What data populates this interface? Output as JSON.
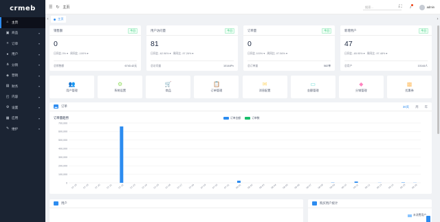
{
  "app": {
    "logo": "crmeb"
  },
  "sidebar": {
    "items": [
      {
        "label": "主页",
        "icon": "home-icon",
        "glyph": "⌂",
        "active": true
      },
      {
        "label": "商品",
        "icon": "goods-icon",
        "glyph": "▣"
      },
      {
        "label": "订单",
        "icon": "order-icon",
        "glyph": "≡"
      },
      {
        "label": "用户",
        "icon": "user-icon",
        "glyph": "●"
      },
      {
        "label": "分销",
        "icon": "distribution-icon",
        "glyph": "⋔"
      },
      {
        "label": "营销",
        "icon": "marketing-icon",
        "glyph": "◈"
      },
      {
        "label": "财务",
        "icon": "finance-icon",
        "glyph": "▤"
      },
      {
        "label": "内容",
        "icon": "content-icon",
        "glyph": "◰"
      },
      {
        "label": "设置",
        "icon": "settings-icon",
        "glyph": "⚙"
      },
      {
        "label": "应用",
        "icon": "apps-icon",
        "glyph": "▦"
      },
      {
        "label": "维护",
        "icon": "maintain-icon",
        "glyph": "✎"
      }
    ]
  },
  "header": {
    "breadcrumb": "主页",
    "search_placeholder": "搜索...",
    "username": "admin"
  },
  "tabs": [
    {
      "label": "主页"
    }
  ],
  "stats": [
    {
      "title": "销售额",
      "tag": "今日",
      "value": "0",
      "day": "日同比 0%",
      "week": "周同比 -100%",
      "foot_label": "总销售额",
      "foot_value": "6743.42元"
    },
    {
      "title": "用户访问量",
      "tag": "今日",
      "value": "81",
      "day": "日同比 -62.96%",
      "week": "周同比 -97.26%",
      "foot_label": "总访问量",
      "foot_value": "10144Pv"
    },
    {
      "title": "订单量",
      "tag": "今日",
      "value": "0",
      "day": "日同比 100%",
      "week": "周同比 -97.56%",
      "foot_label": "总订单量",
      "foot_value": "582单"
    },
    {
      "title": "新增用户",
      "tag": "今日",
      "value": "47",
      "day": "日同比 -65.95%",
      "week": "周同比 -97.48%",
      "foot_label": "总用户",
      "foot_value": "10144人"
    }
  ],
  "shortcuts": [
    {
      "label": "用户管理",
      "icon": "users-icon",
      "glyph": "👥",
      "color": "#69c0ff"
    },
    {
      "label": "系统设置",
      "icon": "gear-icon",
      "glyph": "⚙",
      "color": "#95de64"
    },
    {
      "label": "商品",
      "icon": "cart-icon",
      "glyph": "🛒",
      "color": "#ff9c6e"
    },
    {
      "label": "订单管理",
      "icon": "clipboard-icon",
      "glyph": "📋",
      "color": "#b37feb"
    },
    {
      "label": "消息配置",
      "icon": "mail-icon",
      "glyph": "✉",
      "color": "#ffd666"
    },
    {
      "label": "金额管理",
      "icon": "card-icon",
      "glyph": "▭",
      "color": "#5cdbd3"
    },
    {
      "label": "分销管理",
      "icon": "tag-icon",
      "glyph": "◆",
      "color": "#ff85c0"
    },
    {
      "label": "优惠券",
      "icon": "coupon-icon",
      "glyph": "▩",
      "color": "#ffc069"
    }
  ],
  "order_card": {
    "title": "订单",
    "tools": {
      "range": "30天",
      "period1": "周",
      "period2": "年"
    },
    "subtitle": "订单量趋势"
  },
  "chart_data": {
    "type": "bar",
    "title": "订单量趋势",
    "legend_placement": "top-center",
    "grid": true,
    "ylim": [
      0,
      700000
    ],
    "yticks": [
      0,
      100000,
      200000,
      300000,
      400000,
      500000,
      600000,
      700000
    ],
    "categories": [
      "07-18",
      "07-19",
      "07-20",
      "07-21",
      "07-22",
      "07-23",
      "07-24",
      "07-25",
      "07-26",
      "07-27",
      "07-28",
      "07-29",
      "07-30",
      "07-31",
      "08-01",
      "08-02",
      "08-03",
      "08-04",
      "08-05",
      "08-06",
      "08-07",
      "08-08",
      "08-09",
      "08-10",
      "08-11",
      "08-12",
      "08-13",
      "08-14",
      "08-15",
      "08-16"
    ],
    "series": [
      {
        "name": "订单金额",
        "color": "#2d8cf0",
        "values": [
          0,
          0,
          0,
          0,
          660000,
          0,
          0,
          0,
          0,
          0,
          0,
          0,
          0,
          0,
          25000,
          0,
          0,
          0,
          0,
          0,
          0,
          0,
          3000,
          0,
          15000,
          0,
          1500,
          0,
          4000,
          1500
        ]
      },
      {
        "name": "订单数",
        "color": "#19be6b",
        "values": [
          0,
          0,
          0,
          0,
          1,
          0,
          0,
          0,
          0,
          0,
          0,
          0,
          0,
          0,
          1,
          0,
          0,
          0,
          0,
          0,
          0,
          0,
          1,
          0,
          1,
          0,
          1,
          0,
          1,
          1
        ]
      }
    ]
  },
  "bottom": {
    "left_title": "用户",
    "right_title": "购买用户统计",
    "right_legend": "未消费用户"
  }
}
